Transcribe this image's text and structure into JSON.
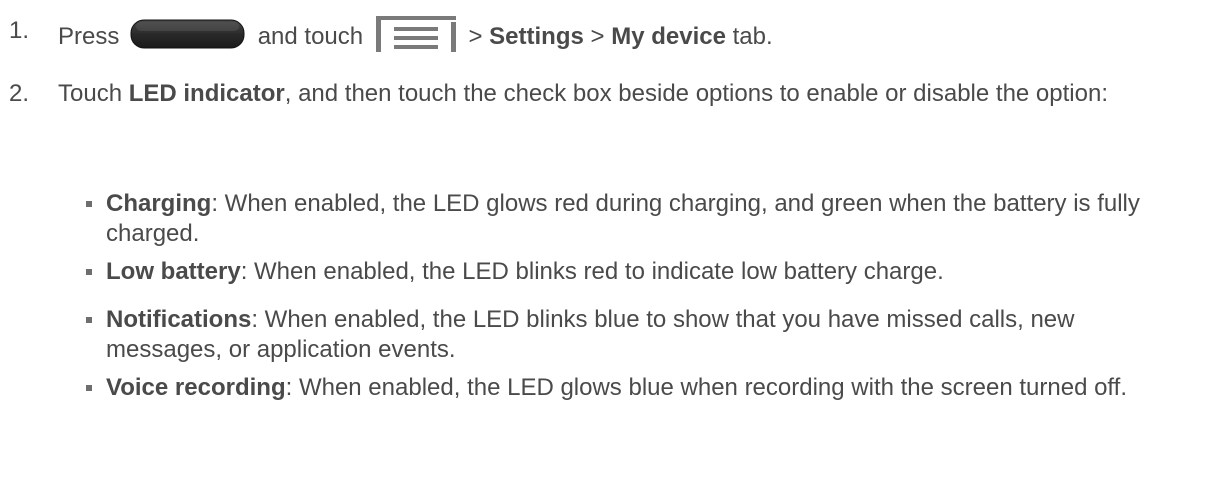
{
  "step1": {
    "num": "1.",
    "press": "Press",
    "and_touch": "and touch",
    "sep1": ">",
    "settings": "Settings",
    "sep2": ">",
    "my_device": "My device",
    "tab": "tab."
  },
  "step2": {
    "num": "2.",
    "touch": "Touch",
    "led_indicator": "LED indicator",
    "rest": ", and then touch the check box beside options to enable or disable the option:"
  },
  "options": [
    {
      "name": "Charging",
      "desc": ": When enabled, the LED glows red during charging, and green when the battery is fully charged."
    },
    {
      "name": "Low battery",
      "desc": ": When enabled, the LED blinks red to indicate low battery charge."
    },
    {
      "name": "Notifications",
      "desc": ": When enabled, the LED blinks blue to show that you have missed calls, new messages, or application events."
    },
    {
      "name": "Voice recording",
      "desc": ": When enabled, the LED glows blue when recording with the screen turned off."
    }
  ],
  "icons": {
    "home_button": "home-button-icon",
    "menu_button": "menu-icon"
  },
  "colors": {
    "text": "#4a4a4a",
    "home_button_dark": "#2b2b2b",
    "menu_icon_gray": "#7a7a7a"
  }
}
